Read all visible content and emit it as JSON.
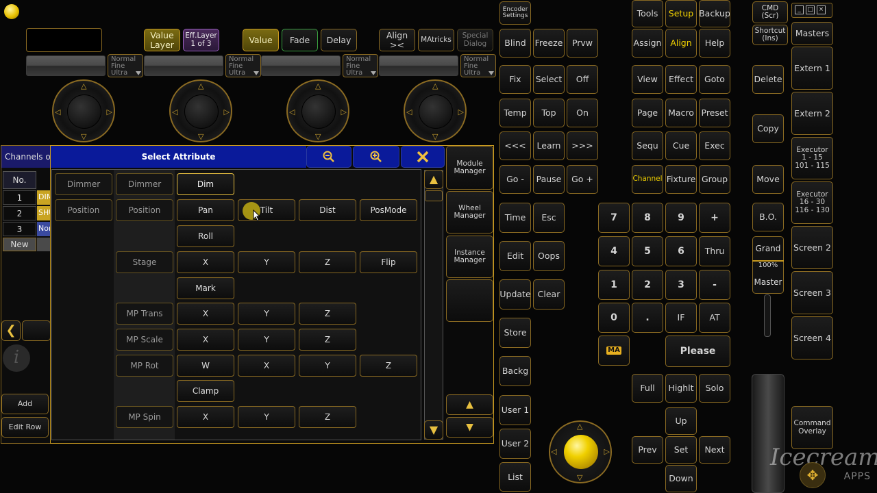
{
  "encoder_bar": {
    "value_layer": "Value\nLayer",
    "eff_layer": "Eff.Layer\n1 of 3",
    "value": "Value",
    "fade": "Fade",
    "delay": "Delay",
    "align": "Align\n><",
    "matricks": "MAtricks",
    "special_dialog": "Special\nDialog",
    "resolution_modes": [
      "Normal\nFine\nUltra",
      "Normal\nFine\nUltra",
      "Normal\nFine\nUltra",
      "Normal\nFine\nUltra"
    ]
  },
  "channels_window": {
    "title": "Channels of",
    "header_no": "No.",
    "rows": [
      {
        "no": "1",
        "name": "DIM"
      },
      {
        "no": "2",
        "name": "SHU"
      },
      {
        "no": "3",
        "name": "Non"
      }
    ],
    "new_label": "New",
    "add_label": "Add",
    "edit_row_label": "Edit Row"
  },
  "dialog": {
    "title": "Select Attribute",
    "features": [
      {
        "group": "Dimmer",
        "feature": "Dimmer",
        "attributes": [
          "Dim"
        ]
      },
      {
        "group": "Position",
        "feature": "Position",
        "attributes": [
          "Pan",
          "Tilt",
          "Dist",
          "PosMode"
        ]
      },
      {
        "group": "",
        "feature": "",
        "attributes": [
          "Roll"
        ]
      },
      {
        "group": "",
        "feature": "Stage",
        "attributes": [
          "X",
          "Y",
          "Z",
          "Flip"
        ]
      },
      {
        "group": "",
        "feature": "",
        "attributes": [
          "Mark"
        ]
      },
      {
        "group": "",
        "feature": "MP Trans",
        "attributes": [
          "X",
          "Y",
          "Z"
        ]
      },
      {
        "group": "",
        "feature": "MP Scale",
        "attributes": [
          "X",
          "Y",
          "Z"
        ]
      },
      {
        "group": "",
        "feature": "MP Rot",
        "attributes": [
          "W",
          "X",
          "Y",
          "Z"
        ]
      },
      {
        "group": "",
        "feature": "",
        "attributes": [
          "Clamp"
        ]
      },
      {
        "group": "",
        "feature": "MP Spin",
        "attributes": [
          "X",
          "Y",
          "Z"
        ]
      }
    ],
    "side_buttons": [
      "Module\nManager",
      "Wheel\nManager",
      "Instance\nManager"
    ]
  },
  "command_keys": {
    "encoder_settings": "Encoder\nSettings",
    "blind": "Blind",
    "freeze": "Freeze",
    "prvw": "Prvw",
    "fix": "Fix",
    "select": "Select",
    "off": "Off",
    "temp": "Temp",
    "top": "Top",
    "on": "On",
    "prev_page": "<<<",
    "learn": "Learn",
    "next_page": ">>>",
    "go_minus": "Go -",
    "pause": "Pause",
    "go_plus": "Go +",
    "time": "Time",
    "esc": "Esc",
    "edit": "Edit",
    "oops": "Oops",
    "update": "Update",
    "clear": "Clear",
    "store": "Store",
    "backg": "Backg",
    "user1": "User 1",
    "user2": "User 2",
    "list": "List",
    "tools": "Tools",
    "setup": "Setup",
    "backup": "Backup",
    "assign": "Assign",
    "align": "Align",
    "help": "Help",
    "view": "View",
    "effect": "Effect",
    "goto": "Goto",
    "page": "Page",
    "macro": "Macro",
    "preset": "Preset",
    "sequ": "Sequ",
    "cue": "Cue",
    "exec": "Exec",
    "channel": "Channel",
    "fixture": "Fixture",
    "group": "Group",
    "n7": "7",
    "n8": "8",
    "n9": "9",
    "plus": "+",
    "n4": "4",
    "n5": "5",
    "n6": "6",
    "thru": "Thru",
    "n1": "1",
    "n2": "2",
    "n3": "3",
    "minus": "-",
    "n0": "0",
    "dot": ".",
    "if": "IF",
    "at": "AT",
    "ma": "MA",
    "please": "Please",
    "full": "Full",
    "highlt": "Highlt",
    "solo": "Solo",
    "up": "Up",
    "prev": "Prev",
    "set": "Set",
    "next": "Next",
    "down": "Down"
  },
  "right_column": {
    "cmd": "CMD\n(Scr)",
    "shortcut": "Shortcut\n(Ins)",
    "masters": "Masters",
    "delete": "Delete",
    "copy": "Copy",
    "move": "Move",
    "bo": "B.O.",
    "grand": "Grand",
    "percent": "100%",
    "master": "Master",
    "extern1": "Extern 1",
    "extern2": "Extern 2",
    "executor1": "Executor\n1 - 15\n101 - 115",
    "executor2": "Executor\n16 - 30\n116 - 130",
    "screen2": "Screen 2",
    "screen3": "Screen 3",
    "screen4": "Screen 4",
    "command_overlay": "Command\nOverlay"
  },
  "watermark": {
    "brand": "Icecream",
    "sub": "APPS"
  },
  "colors": {
    "accent": "#c89a20",
    "highlight": "#f0d000",
    "dialog_title": "#0a1a9a"
  }
}
